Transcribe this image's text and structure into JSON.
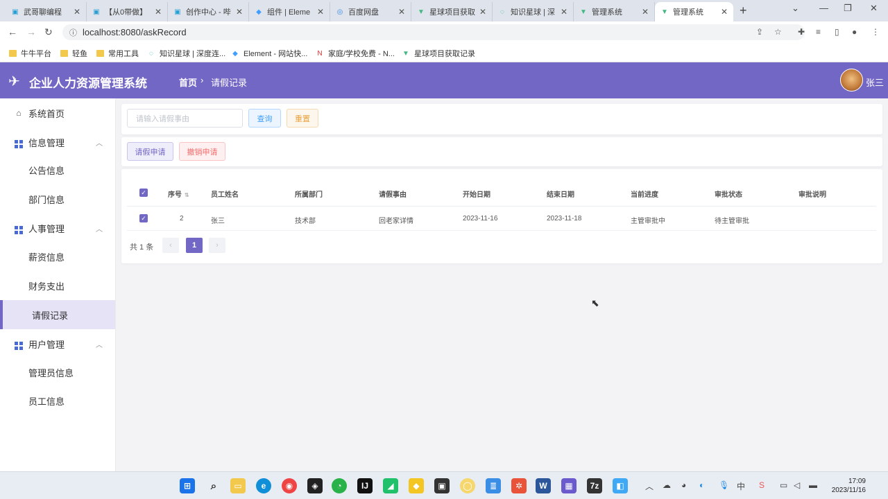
{
  "browser": {
    "tabs": [
      {
        "title": "武哥聊编程",
        "icon": "bilibili-icon",
        "active": false
      },
      {
        "title": "【从0带做】",
        "icon": "bilibili-icon",
        "active": false
      },
      {
        "title": "创作中心 - 哔",
        "icon": "bilibili-icon",
        "active": false
      },
      {
        "title": "组件 | Eleme",
        "icon": "element-icon",
        "active": false
      },
      {
        "title": "百度网盘",
        "icon": "baidu-pan-icon",
        "active": false
      },
      {
        "title": "星球项目获取",
        "icon": "vue-icon",
        "active": false
      },
      {
        "title": "知识星球 | 深",
        "icon": "zsxq-icon",
        "active": false
      },
      {
        "title": "管理系统",
        "icon": "vue-icon",
        "active": false
      },
      {
        "title": "管理系统",
        "icon": "vue-icon",
        "active": true
      }
    ],
    "url": "localhost:8080/askRecord",
    "bookmarks": [
      {
        "label": "牛牛平台",
        "icon": "folder-icon"
      },
      {
        "label": "轻鱼",
        "icon": "folder-icon"
      },
      {
        "label": "常用工具",
        "icon": "folder-icon"
      },
      {
        "label": "知识星球 | 深度连...",
        "icon": "zsxq-icon"
      },
      {
        "label": "Element - 网站快...",
        "icon": "element-icon"
      },
      {
        "label": "家庭/学校免费 - N...",
        "icon": "netease-icon"
      },
      {
        "label": "星球项目获取记录",
        "icon": "vue-icon"
      }
    ]
  },
  "app": {
    "title": "企业人力资源管理系统",
    "breadcrumb": {
      "home": "首页",
      "current": "请假记录"
    },
    "user": {
      "name": "张三"
    },
    "accent_color": "#7367c6"
  },
  "sidebar": {
    "home": "系统首页",
    "groups": [
      {
        "label": "信息管理",
        "items": [
          "公告信息",
          "部门信息"
        ]
      },
      {
        "label": "人事管理",
        "items": [
          "薪资信息",
          "财务支出",
          "请假记录"
        ]
      },
      {
        "label": "用户管理",
        "items": [
          "管理员信息",
          "员工信息"
        ]
      }
    ],
    "active_item": "请假记录"
  },
  "search": {
    "placeholder": "请输入请假事由",
    "query_label": "查询",
    "reset_label": "重置"
  },
  "actions": {
    "apply_label": "请假申请",
    "cancel_label": "撤销申请"
  },
  "table": {
    "columns": [
      "序号",
      "员工姓名",
      "所属部门",
      "请假事由",
      "开始日期",
      "结束日期",
      "当前进度",
      "审批状态",
      "审批说明"
    ],
    "rows": [
      {
        "id": "2",
        "name": "张三",
        "dept": "技术部",
        "reason": "回老家详情",
        "start": "2023-11-16",
        "end": "2023-11-18",
        "progress": "主管审批中",
        "status": "待主管审批",
        "note": ""
      }
    ]
  },
  "pagination": {
    "total_text": "共 1 条",
    "current": "1"
  },
  "taskbar": {
    "time": "17:09",
    "date": "2023/11/16"
  }
}
